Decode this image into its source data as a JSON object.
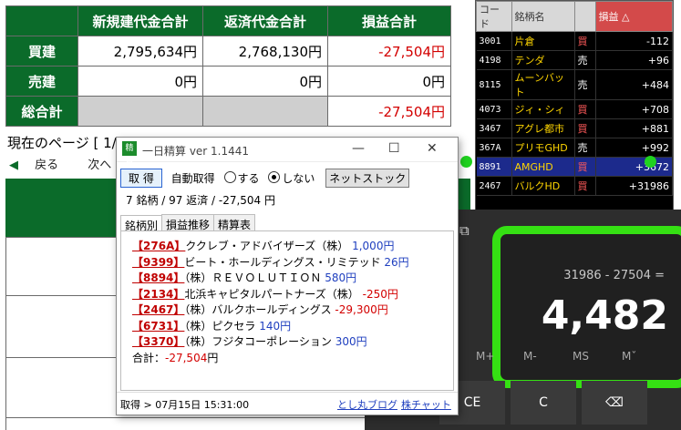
{
  "summary": {
    "headers": [
      "新規建代金合計",
      "返済代金合計",
      "損益合計"
    ],
    "rows": [
      {
        "label": "買建",
        "values": [
          "2,795,634円",
          "2,768,130円",
          "-27,504円"
        ]
      },
      {
        "label": "売建",
        "values": [
          "0円",
          "0円",
          "0円"
        ]
      },
      {
        "label": "総合計",
        "values": [
          "",
          "",
          "-27,504円"
        ]
      }
    ]
  },
  "page_info": "現在のページ [ 1/1 ]",
  "nav": {
    "prev": "戻る",
    "next": "次へ"
  },
  "stocks": {
    "headers": [
      "コード",
      "銘柄名",
      "",
      "損益"
    ],
    "sort_indicator": "△",
    "rows": [
      {
        "code": "3001",
        "name": "片倉",
        "side": "買",
        "pnl": "-112"
      },
      {
        "code": "4198",
        "name": "テンダ",
        "side": "売",
        "pnl": "+96"
      },
      {
        "code": "8115",
        "name": "ムーンバット",
        "side": "売",
        "pnl": "+484"
      },
      {
        "code": "4073",
        "name": "ジィ・シィ",
        "side": "買",
        "pnl": "+708"
      },
      {
        "code": "3467",
        "name": "アグレ都市",
        "side": "買",
        "pnl": "+881"
      },
      {
        "code": "367A",
        "name": "プリモGHD",
        "side": "売",
        "pnl": "+992"
      },
      {
        "code": "8891",
        "name": "AMGHD",
        "side": "買",
        "pnl": "+3672"
      },
      {
        "code": "2467",
        "name": "バルクHD",
        "side": "買",
        "pnl": "+31986"
      }
    ]
  },
  "calculator": {
    "expression": "31986 - 27504 =",
    "result": "4,482",
    "memory_keys": [
      "M+",
      "M-",
      "MS",
      "Mˇ"
    ],
    "keys": [
      "CE",
      "C",
      "⌫"
    ]
  },
  "window": {
    "title": "一日精算 ver 1.1441",
    "logo": "精算",
    "controls": [
      "—",
      "☐",
      "✕"
    ],
    "get_button": "取 得",
    "auto_label": "自動取得",
    "radio_on": "する",
    "radio_off": "しない",
    "net_button": "ネットストック",
    "summary": "7 銘柄 / 97 返済 / -27,504 円",
    "tabs": [
      "銘柄別",
      "損益推移",
      "精算表"
    ],
    "items": [
      {
        "code": "【276A】",
        "name": "ククレブ・アドバイザーズ（株）",
        "pnl": "1,000円",
        "neg": false
      },
      {
        "code": "【9399】",
        "name": "ビート・ホールディングス・リミテッド",
        "pnl": "26円",
        "neg": false
      },
      {
        "code": "【8894】",
        "name": "（株）ＲＥＶＯＬＵＴＩＯＮ",
        "pnl": "580円",
        "neg": false
      },
      {
        "code": "【2134】",
        "name": "北浜キャピタルパートナーズ（株）",
        "pnl": "-250円",
        "neg": true
      },
      {
        "code": "【2467】",
        "name": "（株）バルクホールディングス",
        "pnl": "-29,300円",
        "neg": true
      },
      {
        "code": "【6731】",
        "name": "（株）ピクセラ",
        "pnl": "140円",
        "neg": false
      },
      {
        "code": "【3370】",
        "name": "（株）フジタコーポレーション",
        "pnl": "300円",
        "neg": false
      }
    ],
    "total_label": "合計：",
    "total_value": "-27,504",
    "total_unit": "円",
    "status": "取得 > 07月15日 15:31:00",
    "link1": "とし丸ブログ",
    "link2": "株チャット"
  },
  "colors": {
    "header_green": "#0b6b2a",
    "highlight_green": "#35e013",
    "negative_red": "#d30000"
  }
}
